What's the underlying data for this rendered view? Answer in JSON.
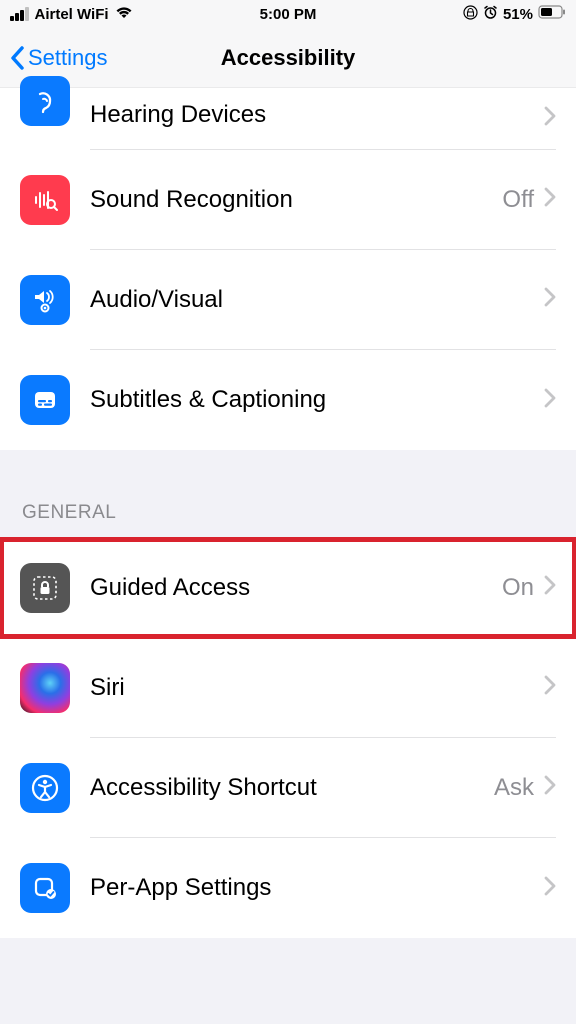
{
  "statusBar": {
    "carrier": "Airtel WiFi",
    "time": "5:00 PM",
    "battery": "51%"
  },
  "nav": {
    "back": "Settings",
    "title": "Accessibility"
  },
  "hearing": {
    "devices": "Hearing Devices",
    "soundRecognition": {
      "label": "Sound Recognition",
      "value": "Off"
    },
    "audioVisual": "Audio/Visual",
    "subtitles": "Subtitles & Captioning"
  },
  "generalHeader": "GENERAL",
  "general": {
    "guidedAccess": {
      "label": "Guided Access",
      "value": "On"
    },
    "siri": "Siri",
    "shortcut": {
      "label": "Accessibility Shortcut",
      "value": "Ask"
    },
    "perApp": "Per-App Settings"
  }
}
